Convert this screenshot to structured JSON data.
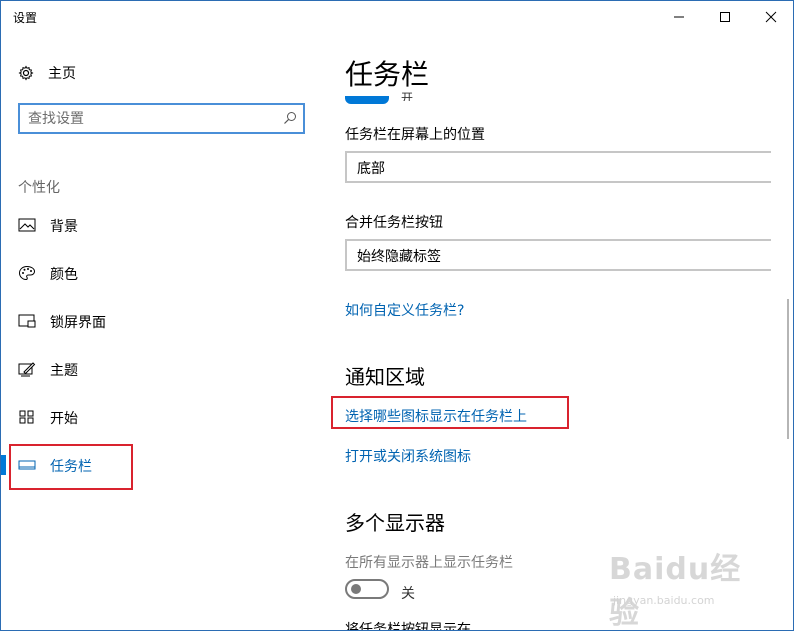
{
  "window": {
    "title": "设置",
    "controls": [
      "minimize",
      "maximize",
      "close"
    ]
  },
  "sidebar": {
    "home": {
      "icon": "gear-icon",
      "label": "主页"
    },
    "search": {
      "placeholder": "查找设置",
      "icon": "search-icon"
    },
    "section_heading": "个性化",
    "items": [
      {
        "icon": "picture-icon",
        "label": "背景"
      },
      {
        "icon": "palette-icon",
        "label": "颜色"
      },
      {
        "icon": "lock-screen-icon",
        "label": "锁屏界面"
      },
      {
        "icon": "theme-brush-icon",
        "label": "主题"
      },
      {
        "icon": "start-tiles-icon",
        "label": "开始"
      },
      {
        "icon": "taskbar-icon",
        "label": "任务栏",
        "active": true
      }
    ]
  },
  "main": {
    "title": "任务栏",
    "toggle_stub_label": "开",
    "position_label": "任务栏在屏幕上的位置",
    "position_value": "底部",
    "combine_label": "合并任务栏按钮",
    "combine_value": "始终隐藏标签",
    "customize_link": "如何自定义任务栏?",
    "notification": {
      "title": "通知区域",
      "link_icons": "选择哪些图标显示在任务栏上",
      "link_system": "打开或关闭系统图标"
    },
    "multi_display": {
      "title": "多个显示器",
      "show_all_label": "在所有显示器上显示任务栏",
      "toggle_state": "关",
      "cutoff_label": "将任务栏按钮显示在"
    }
  },
  "watermark": {
    "brand": "Baidu经验",
    "url": "jingyan.baidu.com"
  },
  "colors": {
    "accent": "#0078d7",
    "link": "#0063b1",
    "highlight_box": "#d9232e"
  }
}
